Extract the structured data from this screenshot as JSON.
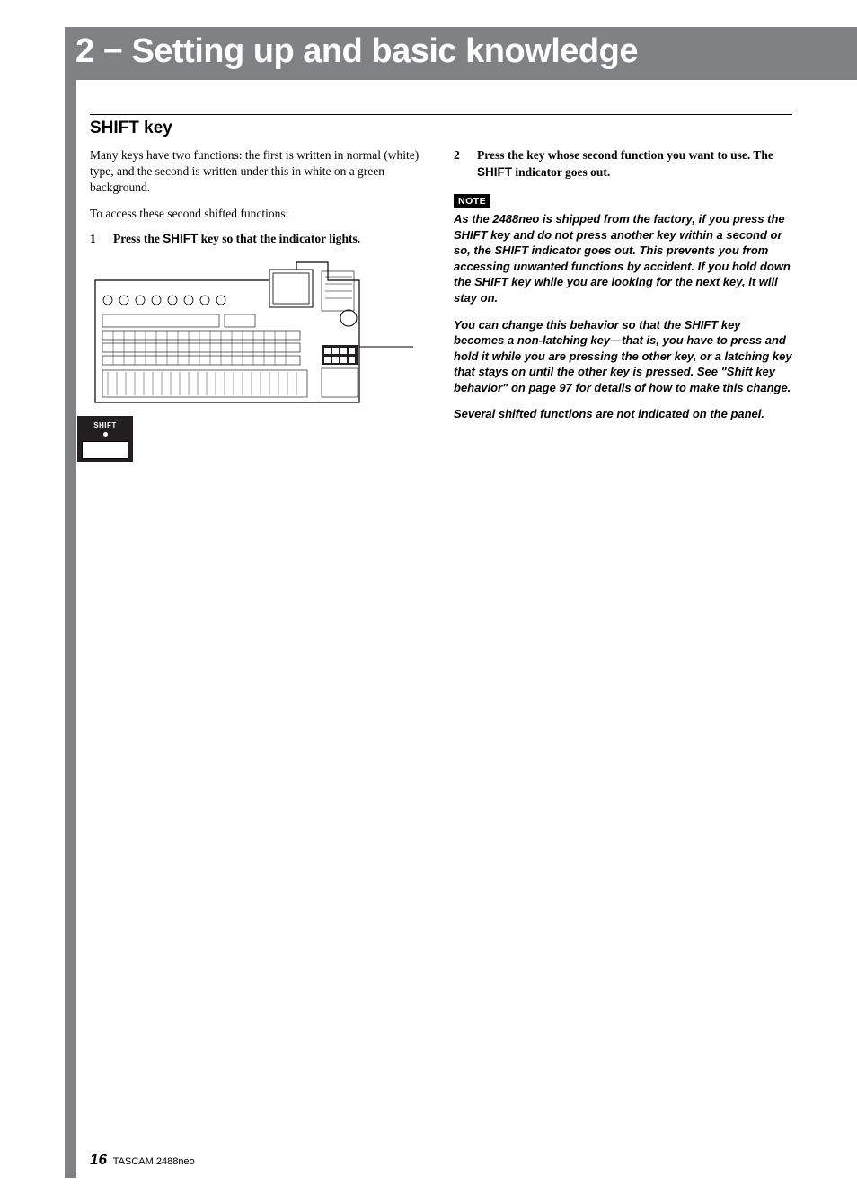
{
  "header": {
    "title": "2 − Setting up and basic knowledge"
  },
  "section": {
    "title": "SHIFT key"
  },
  "intro": {
    "p1": "Many keys have two functions: the first is written in normal (white) type, and the second is written under this in white on a green background.",
    "p2": "To access these second shifted functions:"
  },
  "steps": {
    "s1_num": "1",
    "s1_a": "Press the ",
    "s1_key": "SHIFT",
    "s1_b": " key so that the indicator lights.",
    "s2_num": "2",
    "s2_a": "Press the key whose second function you want to use. The ",
    "s2_key": "SHIFT",
    "s2_b": " indicator goes out."
  },
  "callout": {
    "label": "SHIFT"
  },
  "note": {
    "badge": "NOTE",
    "p1": "As the 2488neo is shipped from the factory, if you press the SHIFT key and do not press another key within a second or so, the SHIFT indicator goes out. This prevents you from accessing unwanted functions by accident. If you hold down the SHIFT key while you are looking for the next key, it will stay on.",
    "p2": "You can change this behavior so that the SHIFT key becomes a non-latching key—that is, you have to press and hold it while you are pressing the other key, or a latching key that stays on until the other key is pressed. See \"Shift key behavior\" on page 97 for details of how to make this change.",
    "p3": "Several shifted functions are not indicated on the panel."
  },
  "footer": {
    "page": "16",
    "brand": "TASCAM  2488neo"
  }
}
